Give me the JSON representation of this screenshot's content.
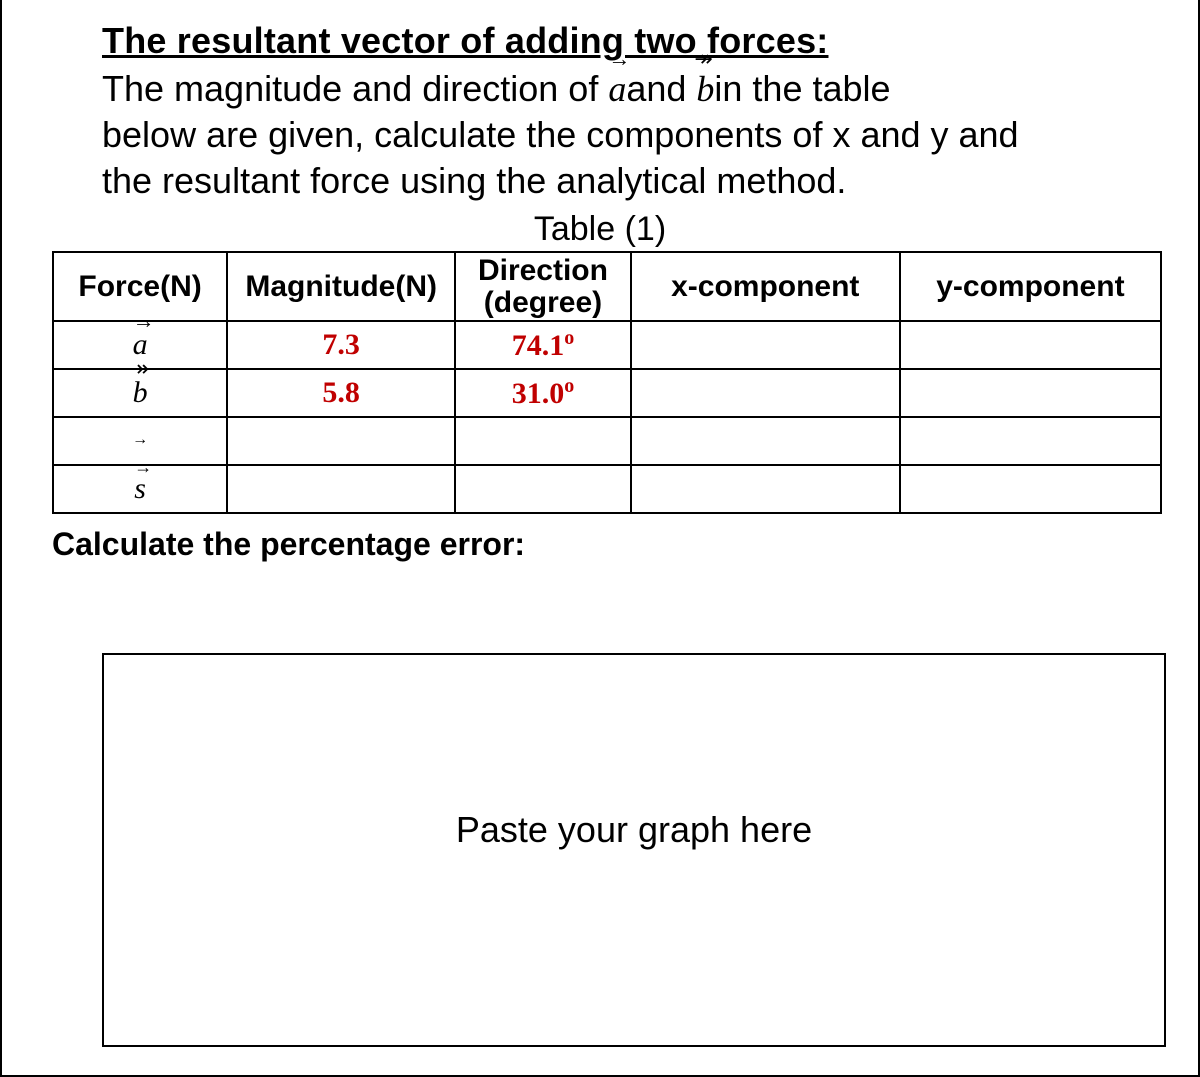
{
  "heading": "The resultant vector of adding two forces:",
  "body_line1_pre": "The magnitude and direction of ",
  "body_line1_mid": "and ",
  "body_line1_post": "in the table",
  "body_line2": "below are given, calculate the components of x and y and",
  "body_line3": "the resultant force using the analytical method.",
  "table_caption": "Table (1)",
  "headers": {
    "force": "Force(N)",
    "magnitude": "Magnitude(N)",
    "direction_line1": "Direction",
    "direction_line2": "(degree)",
    "xcomp": "x-component",
    "ycomp": "y-component"
  },
  "rows": {
    "a": {
      "symbol": "a",
      "arrow": "single",
      "magnitude": "7.3",
      "direction_num": "74.1",
      "direction_deg": "o"
    },
    "b": {
      "symbol": "b",
      "arrow": "double",
      "magnitude": "5.8",
      "direction_num": "31.0",
      "direction_deg": "o"
    },
    "blank": {
      "symbol": "",
      "arrow": "tiny"
    },
    "s": {
      "symbol": "s",
      "arrow": "single"
    }
  },
  "error_label": "Calculate the percentage error:",
  "graph_placeholder": "Paste your graph here"
}
